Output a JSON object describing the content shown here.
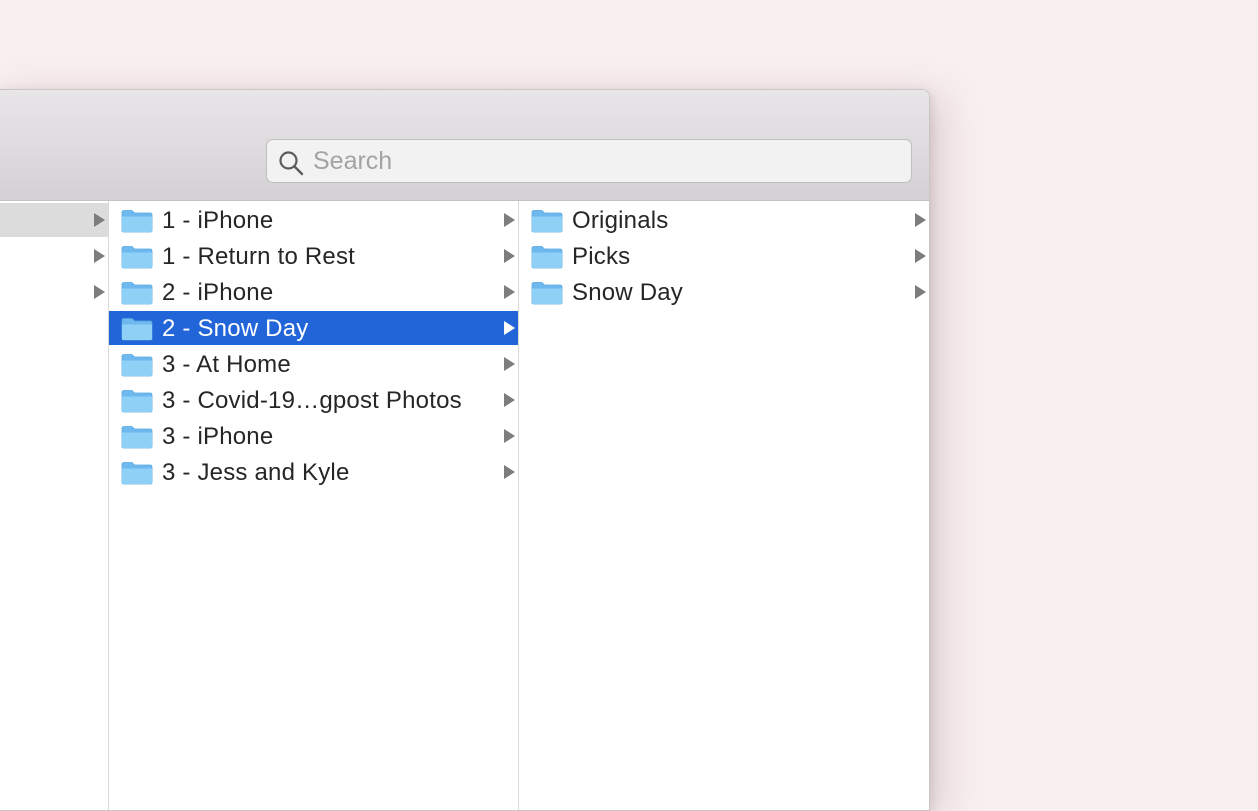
{
  "search": {
    "placeholder": "Search",
    "value": ""
  },
  "columns": [
    {
      "rows": [
        {
          "active": true
        },
        {
          "active": false
        },
        {
          "active": false
        }
      ]
    },
    {
      "items": [
        "1 - iPhone",
        "1 - Return to Rest",
        "2 - iPhone",
        "2 - Snow Day",
        "3 - At Home",
        "3 - Covid-19…gpost Photos",
        "3 - iPhone",
        "3 - Jess and Kyle"
      ],
      "selected": "2 - Snow Day"
    },
    {
      "items": [
        "Originals",
        "Picks",
        "Snow Day"
      ]
    }
  ],
  "colors": {
    "selection": "#2165d8",
    "folder_blue": "#7cc3f2",
    "background": "#f9eff0"
  },
  "icons": {
    "search": "magnifier-icon",
    "folder": "folder-icon",
    "disclosure": "disclosure-triangle-icon"
  }
}
